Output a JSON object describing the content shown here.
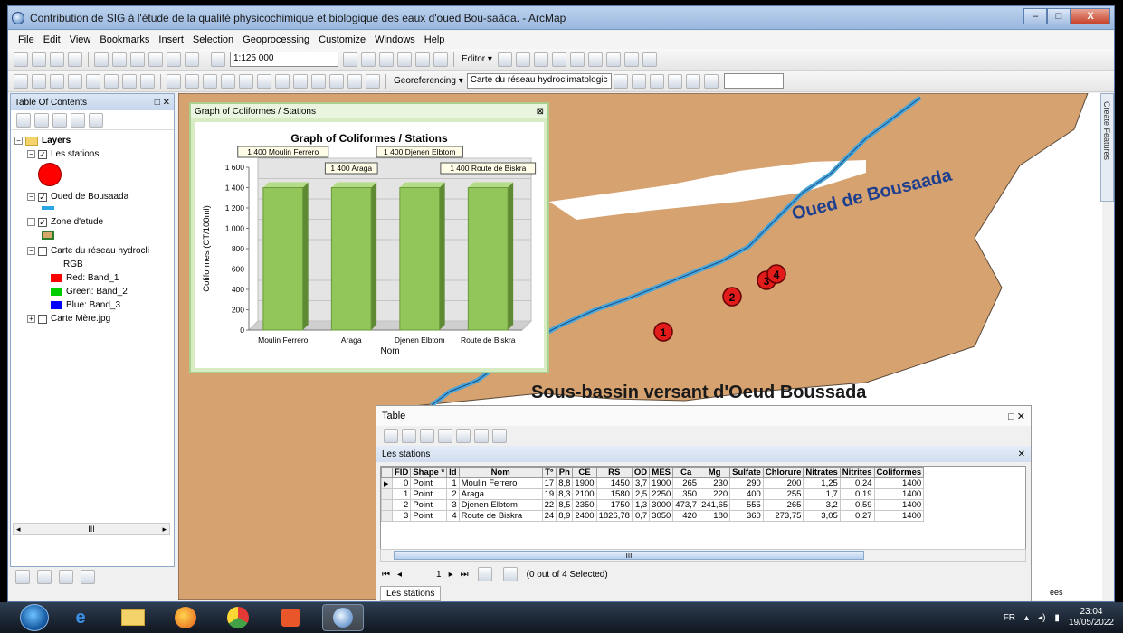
{
  "window": {
    "title": "Contribution de SIG à l'étude de la qualité physicochimique et biologique des eaux d'oued  Bou-saâda. - ArcMap",
    "minimize": "–",
    "maximize": "□",
    "close": "X"
  },
  "menu": [
    "File",
    "Edit",
    "View",
    "Bookmarks",
    "Insert",
    "Selection",
    "Geoprocessing",
    "Customize",
    "Windows",
    "Help"
  ],
  "toolbar": {
    "scale": "1:125 000",
    "editor": "Editor ▾",
    "georeferencing": "Georeferencing ▾",
    "georef_layer": "Carte du réseau hydroclimatologic"
  },
  "toc": {
    "title": "Table Of Contents",
    "close": "□ ✕",
    "layers_label": "Layers",
    "items": [
      {
        "label": "Les stations",
        "checked": true
      },
      {
        "label": "Oued de Bousaada",
        "checked": true
      },
      {
        "label": "Zone d'etude",
        "checked": true
      },
      {
        "label": "Carte du réseau hydrocli",
        "checked": false
      },
      {
        "label": "Carte Mère.jpg",
        "checked": false
      }
    ],
    "rgb_label": "RGB",
    "bands": [
      {
        "label": "Red:   Band_1",
        "color": "#ff0000"
      },
      {
        "label": "Green: Band_2",
        "color": "#00cc00"
      },
      {
        "label": "Blue:  Band_3",
        "color": "#0000ff"
      }
    ],
    "scroll_mark": "III"
  },
  "map": {
    "river_label": "Oued de Bousaada",
    "basin_label": "Sous-bassin versant d'Oeud Boussada",
    "station_labels": [
      "1",
      "2",
      "3",
      "4"
    ],
    "side_panel": "Create Features"
  },
  "graph_window": {
    "title": "Graph of Coliformes / Stations",
    "close": "⊠"
  },
  "chart_data": {
    "type": "bar",
    "title": "Graph of Coliformes / Stations",
    "xlabel": "Nom",
    "ylabel": "Coliformes (CT/100ml)",
    "categories": [
      "Moulin Ferrero",
      "Araga",
      "Djenen Elbtom",
      "Route de Biskra"
    ],
    "values": [
      1400,
      1400,
      1400,
      1400
    ],
    "data_labels": [
      "1 400 Moulin Ferrero",
      "1 400 Araga",
      "1 400 Djenen Elbtom",
      "1 400 Route de Biskra"
    ],
    "ylim": [
      0,
      1600
    ],
    "yticks": [
      0,
      200,
      400,
      600,
      800,
      1000,
      1200,
      1400,
      1600
    ],
    "ytick_labels": [
      "0",
      "200",
      "400",
      "600",
      "800",
      "1 000",
      "1 200",
      "1 400",
      "1 600"
    ],
    "bar_color": "#92c65a",
    "grid": true
  },
  "table": {
    "title": "Table",
    "close": "□ ✕",
    "layer_tab": "Les stations",
    "layer_close": "✕",
    "columns": [
      "FID",
      "Shape *",
      "Id",
      "Nom",
      "T°",
      "Ph",
      "CE",
      "RS",
      "OD",
      "MES",
      "Ca",
      "Mg",
      "Sulfate",
      "Chlorure",
      "Nitrates",
      "Nitrites",
      "Coliformes"
    ],
    "rows": [
      [
        "0",
        "Point",
        "1",
        "Moulin Ferrero",
        "17",
        "8,8",
        "1900",
        "1450",
        "3,7",
        "1900",
        "265",
        "230",
        "290",
        "200",
        "1,25",
        "0,24",
        "1400"
      ],
      [
        "1",
        "Point",
        "2",
        "Araga",
        "19",
        "8,3",
        "2100",
        "1580",
        "2,5",
        "2250",
        "350",
        "220",
        "400",
        "255",
        "1,7",
        "0,19",
        "1400"
      ],
      [
        "2",
        "Point",
        "3",
        "Djenen Elbtom",
        "22",
        "8,5",
        "2350",
        "1750",
        "1,3",
        "3000",
        "473,7",
        "241,65",
        "555",
        "265",
        "3,2",
        "0,59",
        "1400"
      ],
      [
        "3",
        "Point",
        "4",
        "Route de Biskra",
        "24",
        "8,9",
        "2400",
        "1826,78",
        "0,7",
        "3050",
        "420",
        "180",
        "360",
        "273,75",
        "3,05",
        "0,27",
        "1400"
      ]
    ],
    "scroll_mark": "III",
    "nav_first": "⏮",
    "nav_prev": "◂",
    "nav_page": "1",
    "nav_next": "▸",
    "nav_last": "⏭",
    "selection_status": "(0 out of 4 Selected)",
    "bottom_tab": "Les stations"
  },
  "taskbar": {
    "language": "FR",
    "time": "23:04",
    "date": "19/05/2022",
    "edge_label": "ees"
  }
}
